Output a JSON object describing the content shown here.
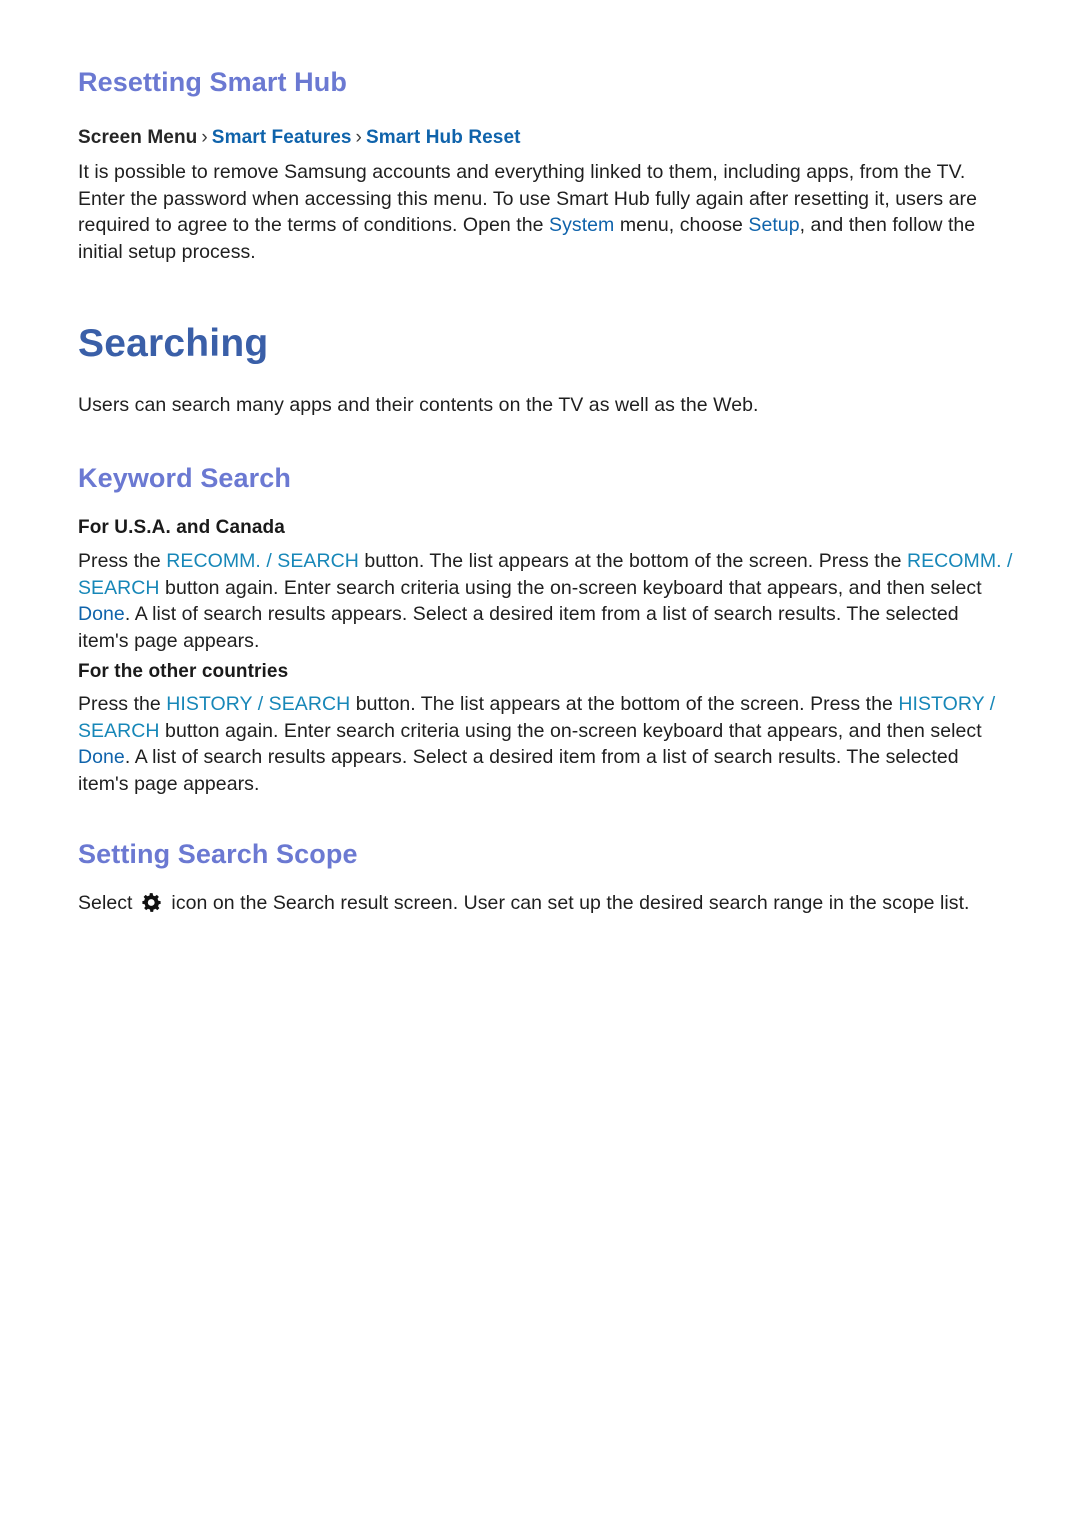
{
  "document": {
    "section_1": {
      "heading": "Resetting Smart Hub",
      "breadcrumb": {
        "root": "Screen Menu",
        "separator": "›",
        "link_1": "Smart Features",
        "link_2": "Smart Hub Reset"
      },
      "paragraph": {
        "part_1": "It is possible to remove Samsung accounts and everything linked to them, including apps, from the TV. Enter the password when accessing this menu. To use Smart Hub fully again after resetting it, users are required to agree to the terms of conditions. Open the ",
        "link_system": "System",
        "part_2": " menu, choose ",
        "link_setup": "Setup",
        "part_3": ", and then follow the initial setup process."
      }
    },
    "chapter": {
      "heading": "Searching",
      "intro": "Users can search many apps and their contents on the TV as well as the Web."
    },
    "section_2": {
      "heading": "Keyword Search",
      "sub_1": {
        "label": "For U.S.A. and Canada",
        "part_1": "Press the ",
        "key_1": "RECOMM. / SEARCH",
        "part_2": " button. The list appears at the bottom of the screen. Press the ",
        "key_2": "RECOMM. / SEARCH",
        "part_3": " button again. Enter search criteria using the on-screen keyboard that appears, and then select ",
        "key_done": "Done",
        "part_4": ". A list of search results appears. Select a desired item from a list of search results. The selected item's page appears."
      },
      "sub_2": {
        "label": "For the other countries",
        "part_1": "Press the ",
        "key_1": "HISTORY / SEARCH",
        "part_2": " button. The list appears at the bottom of the screen. Press the ",
        "key_2": "HISTORY / SEARCH",
        "part_3": " button again. Enter search criteria using the on-screen keyboard that appears, and then select ",
        "key_done": "Done",
        "part_4": ". A list of search results appears. Select a desired item from a list of search results. The selected item's page appears."
      }
    },
    "section_3": {
      "heading": "Setting Search Scope",
      "paragraph": {
        "part_1": "Select ",
        "icon": "gear-icon",
        "part_2": " icon on the Search result screen. User can set up the desired search range in the scope list."
      }
    },
    "colors": {
      "heading_periwinkle": "#6b79d2",
      "chapter_blue": "#3a5fa8",
      "link_blue": "#0f63ab",
      "key_teal": "#1787b8",
      "body_text": "#1f1f1f",
      "page_background": "#ffffff"
    }
  }
}
